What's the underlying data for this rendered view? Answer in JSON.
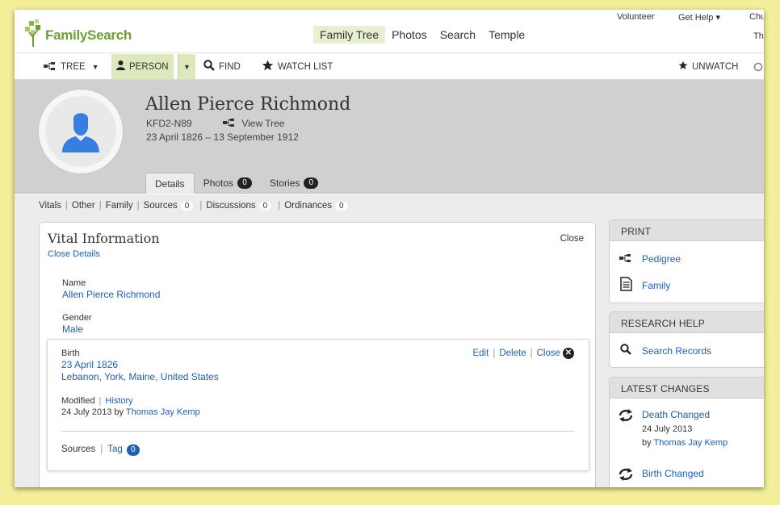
{
  "brand": {
    "name": "FamilySearch"
  },
  "nav": {
    "items": [
      "Family Tree",
      "Photos",
      "Search",
      "Temple"
    ],
    "active": "Family Tree"
  },
  "util_links": {
    "volunteer": "Volunteer",
    "get_help": "Get Help ▾",
    "church_truncated": "Chu",
    "th_truncated": "Th"
  },
  "toolbar": {
    "tree": "TREE",
    "person": "PERSON",
    "find": "FIND",
    "watch_list": "WATCH LIST",
    "unwatch": "UNWATCH"
  },
  "person": {
    "name": "Allen Pierce Richmond",
    "id": "KFD2-N89",
    "view_tree": "View Tree",
    "dates": "23 April 1826 – 13 September 1912"
  },
  "tabs": {
    "details": "Details",
    "photos": "Photos",
    "photos_count": "0",
    "stories": "Stories",
    "stories_count": "0"
  },
  "section_nav": {
    "vitals": "Vitals",
    "other": "Other",
    "family": "Family",
    "sources": "Sources",
    "sources_count": "0",
    "discussions": "Discussions",
    "discussions_count": "0",
    "ordinances": "Ordinances",
    "ordinances_count": "0"
  },
  "vital": {
    "title": "Vital Information",
    "close": "Close",
    "close_details": "Close Details",
    "name_label": "Name",
    "name_value": "Allen Pierce Richmond",
    "gender_label": "Gender",
    "gender_value": "Male",
    "birth": {
      "label": "Birth",
      "date": "23 April 1826",
      "place": "Lebanon, York, Maine, United States",
      "edit": "Edit",
      "delete": "Delete",
      "close": "Close",
      "modified_label": "Modified",
      "history": "History",
      "modified_date": "24 July 2013 by",
      "modified_by": "Thomas Jay Kemp",
      "sources": "Sources",
      "tag": "Tag",
      "tag_count": "0"
    }
  },
  "print_panel": {
    "title": "PRINT",
    "pedigree": "Pedigree",
    "family": "Family"
  },
  "research_panel": {
    "title": "RESEARCH HELP",
    "search_records": "Search Records"
  },
  "changes_panel": {
    "title": "LATEST CHANGES",
    "items": [
      {
        "title": "Death Changed",
        "date": "24 July 2013",
        "by_prefix": "by",
        "by_name": "Thomas Jay Kemp"
      },
      {
        "title": "Birth Changed"
      }
    ]
  },
  "colors": {
    "brand_green": "#6f9e3a",
    "link_blue": "#1f5fb0",
    "header_gray": "#d0d0d0",
    "avatar_blue": "#3a7de0",
    "page_frame_yellow": "#f2ee9a"
  }
}
